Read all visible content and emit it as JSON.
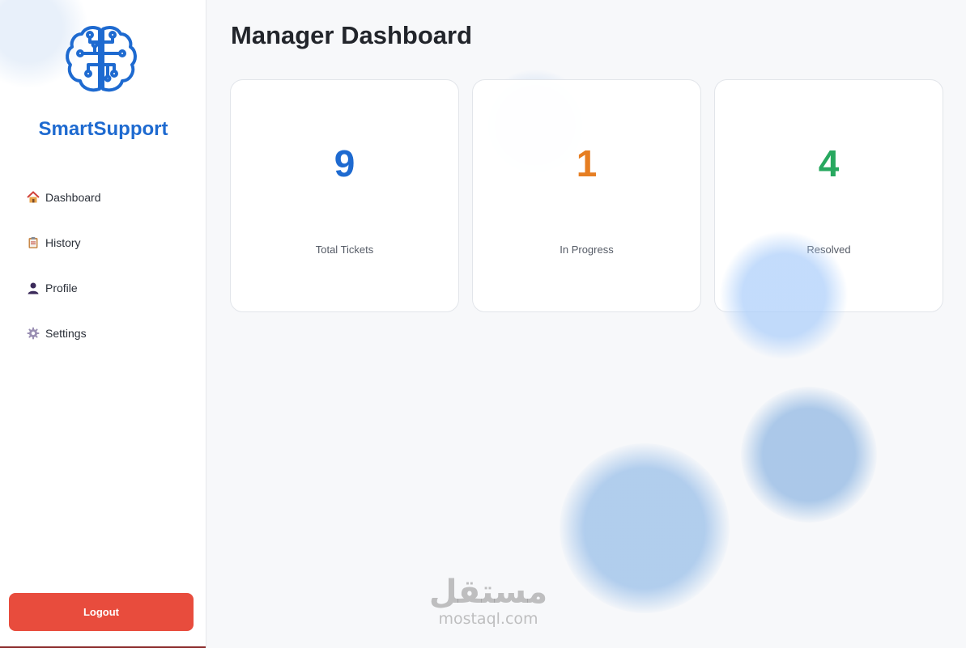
{
  "sidebar": {
    "brand": "SmartSupport",
    "items": [
      {
        "label": "Dashboard",
        "icon": "house-icon"
      },
      {
        "label": "History",
        "icon": "clipboard-icon"
      },
      {
        "label": "Profile",
        "icon": "user-icon"
      },
      {
        "label": "Settings",
        "icon": "gear-icon"
      }
    ],
    "logout_label": "Logout"
  },
  "main": {
    "title": "Manager Dashboard",
    "cards": [
      {
        "value": "9",
        "label": "Total Tickets",
        "color": "#1e6ad0"
      },
      {
        "value": "1",
        "label": "In Progress",
        "color": "#e67e22"
      },
      {
        "value": "4",
        "label": "Resolved",
        "color": "#27a85f"
      }
    ]
  },
  "watermark": {
    "arabic": "مستقل",
    "domain": "mostaql.com"
  },
  "colors": {
    "accent": "#1e6ad0",
    "logout": "#e84c3d"
  }
}
